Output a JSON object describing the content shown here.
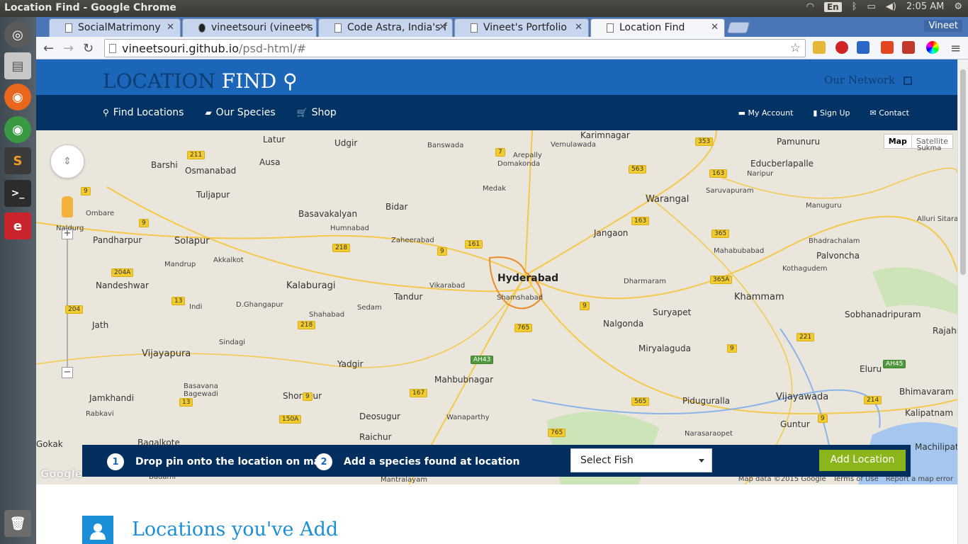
{
  "window": {
    "title": "Location Find - Google Chrome"
  },
  "system_tray": {
    "lang": "En",
    "time": "2:05 AM"
  },
  "launcher": {
    "items": [
      "dash-icon",
      "files-icon",
      "firefox-icon",
      "chrome-icon",
      "sublime-icon",
      "terminal-icon",
      "app-icon",
      "trash-icon"
    ]
  },
  "browser": {
    "tabs": [
      {
        "label": "SocialMatrimony"
      },
      {
        "label": "vineetsouri (vineet s"
      },
      {
        "label": "Code Astra, India's f"
      },
      {
        "label": "Vineet's Portfolio"
      },
      {
        "label": "Location Find"
      }
    ],
    "profile": "Vineet",
    "url_host": "vineetsouri.github.io",
    "url_path": "/psd-html/#"
  },
  "site": {
    "logo_a": "LOCATION",
    "logo_b": "FIND",
    "network": "Our Network",
    "main_nav": [
      {
        "label": "Find Locations",
        "icon": "map-marker-icon"
      },
      {
        "label": "Our Species",
        "icon": "book-icon"
      },
      {
        "label": "Shop",
        "icon": "cart-icon"
      }
    ],
    "sub_nav": [
      {
        "label": "My Account",
        "icon": "folder-icon"
      },
      {
        "label": "Sign Up",
        "icon": "bookmark-icon"
      },
      {
        "label": "Contact",
        "icon": "envelope-icon"
      }
    ]
  },
  "map": {
    "type_map": "Map",
    "type_satellite": "Satellite",
    "cities": [
      {
        "name": "Latur"
      },
      {
        "name": "Udgir"
      },
      {
        "name": "Banswada"
      },
      {
        "name": "Karimnagar"
      },
      {
        "name": "Vemulawada"
      },
      {
        "name": "Pamunuru"
      },
      {
        "name": "Barshi"
      },
      {
        "name": "Osmanabad"
      },
      {
        "name": "Ausa"
      },
      {
        "name": "Arepally"
      },
      {
        "name": "Domakonda"
      },
      {
        "name": "Educberlapalle"
      },
      {
        "name": "Naripur"
      },
      {
        "name": "Tuljapur"
      },
      {
        "name": "Medak"
      },
      {
        "name": "Saruvapuram"
      },
      {
        "name": "Warangal"
      },
      {
        "name": "Ombare"
      },
      {
        "name": "Basavakalyan"
      },
      {
        "name": "Bidar"
      },
      {
        "name": "Manuguru"
      },
      {
        "name": "Humnabad"
      },
      {
        "name": "Naldurg"
      },
      {
        "name": "Jangaon"
      },
      {
        "name": "Alluri Sitara"
      },
      {
        "name": "Pandharpur"
      },
      {
        "name": "Solapur"
      },
      {
        "name": "Zaheerabad"
      },
      {
        "name": "Bhadrachalam"
      },
      {
        "name": "Mahabubabad"
      },
      {
        "name": "Palvoncha"
      },
      {
        "name": "Mandrup"
      },
      {
        "name": "Akkalkot"
      },
      {
        "name": "Hyderabad"
      },
      {
        "name": "Kothagudem"
      },
      {
        "name": "Nandeshwar"
      },
      {
        "name": "Kalaburagi"
      },
      {
        "name": "Vikarabad"
      },
      {
        "name": "Dharmaram"
      },
      {
        "name": "Shamshabad"
      },
      {
        "name": "Khammam"
      },
      {
        "name": "Indi"
      },
      {
        "name": "D.Ghangapur"
      },
      {
        "name": "Tandur"
      },
      {
        "name": "Suryapet"
      },
      {
        "name": "Sobhanadripuram"
      },
      {
        "name": "Rajahmu"
      },
      {
        "name": "Shahabad"
      },
      {
        "name": "Sedam"
      },
      {
        "name": "Jath"
      },
      {
        "name": "Nalgonda"
      },
      {
        "name": "Sindagi"
      },
      {
        "name": "Miryalaguda"
      },
      {
        "name": "Vijayapura"
      },
      {
        "name": "Yadgir"
      },
      {
        "name": "Eluru"
      },
      {
        "name": "Mahbubnagar"
      },
      {
        "name": "Basavana Bagewadi"
      },
      {
        "name": "Bhimavaram"
      },
      {
        "name": "Jamkhandi"
      },
      {
        "name": "Shorapur"
      },
      {
        "name": "Piduguralla"
      },
      {
        "name": "Vijayawada"
      },
      {
        "name": "Rabkavi"
      },
      {
        "name": "Deosugur"
      },
      {
        "name": "Wanaparthy"
      },
      {
        "name": "Kalipatnam"
      },
      {
        "name": "Guntur"
      },
      {
        "name": "Gokak"
      },
      {
        "name": "Raichur"
      },
      {
        "name": "Narasaraopet"
      },
      {
        "name": "Bagalkote"
      },
      {
        "name": "Sukma"
      },
      {
        "name": "Mantralayam"
      },
      {
        "name": "Badami"
      },
      {
        "name": "Machilipatnam"
      }
    ],
    "shields": [
      "211",
      "9",
      "7",
      "353",
      "563",
      "163",
      "9",
      "218",
      "161",
      "163",
      "365",
      "204A",
      "9",
      "365A",
      "13",
      "204",
      "218",
      "9",
      "765",
      "9",
      "221",
      "AH43",
      "AH45",
      "167",
      "565",
      "214",
      "13",
      "150A",
      "9",
      "765",
      "9"
    ],
    "attribution": "Map data ©2015 Google",
    "terms": "Terms of Use",
    "report": "Report a map error",
    "google": "Google"
  },
  "stepbar": {
    "step1_num": "1",
    "step1_text": "Drop pin onto the location on map",
    "step2_num": "2",
    "step2_text": "Add a species found at location",
    "select_value": "Select Fish",
    "add_button": "Add Location"
  },
  "section": {
    "title": "Locations you've Add",
    "icon": "user-icon"
  }
}
